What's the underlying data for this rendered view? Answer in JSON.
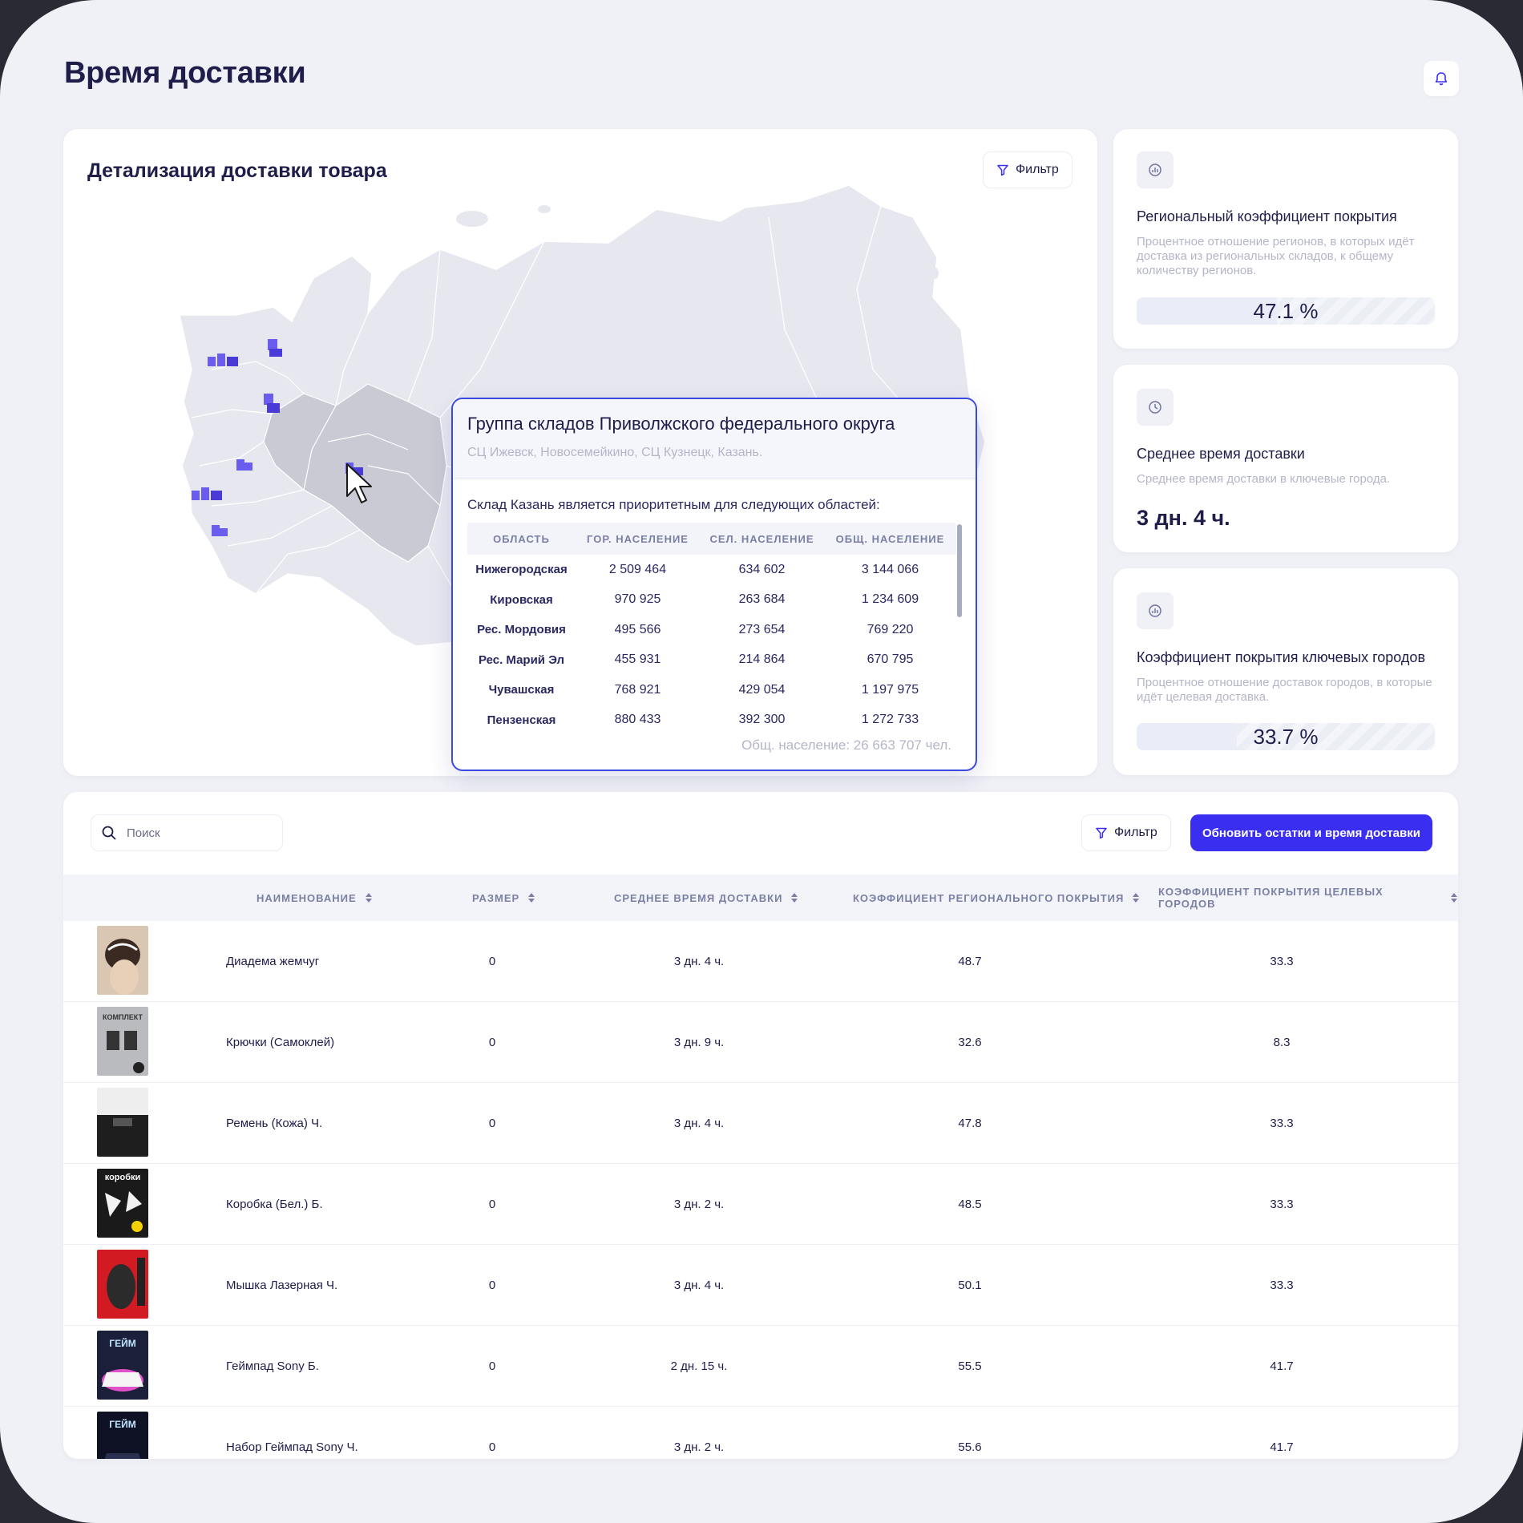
{
  "page": {
    "title": "Время доставки"
  },
  "map_card": {
    "title": "Детализация доставки товара",
    "filter_label": "Фильтр"
  },
  "popup": {
    "title": "Группа складов Приволжского федерального округа",
    "subtitle": "СЦ Ижевск, Новосемейкино, СЦ Кузнецк, Казань.",
    "note": "Склад Казань является приоритетным для следующих областей:",
    "columns": [
      "ОБЛАСТЬ",
      "ГОР. НАСЕЛЕНИЕ",
      "СЕЛ. НАСЕЛЕНИЕ",
      "ОБЩ. НАСЕЛЕНИЕ"
    ],
    "rows": [
      [
        "Нижегородская",
        "2 509 464",
        "634 602",
        "3 144 066"
      ],
      [
        "Кировская",
        "970 925",
        "263 684",
        "1 234 609"
      ],
      [
        "Рес. Мордовия",
        "495 566",
        "273 654",
        "769 220"
      ],
      [
        "Рес. Марий Эл",
        "455 931",
        "214 864",
        "670 795"
      ],
      [
        "Чувашская",
        "768 921",
        "429 054",
        "1 197 975"
      ],
      [
        "Пензенская",
        "880 433",
        "392 300",
        "1 272 733"
      ]
    ],
    "total": "Общ. население: 26 663 707 чел."
  },
  "stats": [
    {
      "title": "Региональный коэффициент покрытия",
      "description": "Процентное отношение регионов, в которых идёт доставка из региональных складов, к общему количеству регионов.",
      "value": "47.1 %",
      "fraction": 0.471,
      "icon": "chart-circle-icon"
    },
    {
      "title": "Среднее время доставки",
      "description": "Среднее время доставки в ключевые города.",
      "value": "3 дн. 4 ч.",
      "icon": "clock-icon"
    },
    {
      "title": "Коэффициент покрытия ключевых городов",
      "description": "Процентное отношение доставок городов, в которые идёт целевая доставка.",
      "value": "33.7 %",
      "fraction": 0.337,
      "icon": "chart-circle-icon"
    }
  ],
  "table": {
    "search_placeholder": "Поиск",
    "filter_label": "Фильтр",
    "update_button": "Обновить остатки и время доставки",
    "columns": {
      "name": "НАИМЕНОВАНИЕ",
      "size": "РАЗМЕР",
      "avg_time": "СРЕДНЕЕ ВРЕМЯ ДОСТАВКИ",
      "regional": "КОЭФФИЦИЕНТ РЕГИОНАЛЬНОГО ПОКРЫТИЯ",
      "target": "КОЭФФИЦИЕНТ ПОКРЫТИЯ ЦЕЛЕВЫХ ГОРОДОВ"
    },
    "rows": [
      {
        "name": "Диадема жемчуг",
        "size": "0",
        "avg_time": "3 дн. 4 ч.",
        "regional": "48.7",
        "target": "33.3",
        "thumb": "tiara"
      },
      {
        "name": "Крючки (Самоклей)",
        "size": "0",
        "avg_time": "3 дн. 9 ч.",
        "regional": "32.6",
        "target": "8.3",
        "thumb": "hooks",
        "thumb_text": "КОМПЛЕКТ"
      },
      {
        "name": "Ремень (Кожа) Ч.",
        "size": "0",
        "avg_time": "3 дн. 4 ч.",
        "regional": "47.8",
        "target": "33.3",
        "thumb": "belt"
      },
      {
        "name": "Коробка (Бел.) Б.",
        "size": "0",
        "avg_time": "3 дн. 2 ч.",
        "regional": "48.5",
        "target": "33.3",
        "thumb": "boxes",
        "thumb_text": "коробки"
      },
      {
        "name": "Мышка Лазерная Ч.",
        "size": "0",
        "avg_time": "3 дн. 4 ч.",
        "regional": "50.1",
        "target": "33.3",
        "thumb": "mouse"
      },
      {
        "name": "Геймпад Sony Б.",
        "size": "0",
        "avg_time": "2 дн. 15 ч.",
        "regional": "55.5",
        "target": "41.7",
        "thumb": "gamepad",
        "thumb_text": "ГЕЙМ"
      },
      {
        "name": "Набор Геймпад Sony Ч.",
        "size": "0",
        "avg_time": "3 дн. 2 ч.",
        "regional": "55.6",
        "target": "41.7",
        "thumb": "gamepad-dark",
        "thumb_text": "ГЕЙМ"
      }
    ]
  },
  "colors": {
    "accent": "#3a2ef0",
    "popup_border": "#3a49e0",
    "warehouse": "#6b5cf0",
    "text": "#1f1d4a"
  }
}
